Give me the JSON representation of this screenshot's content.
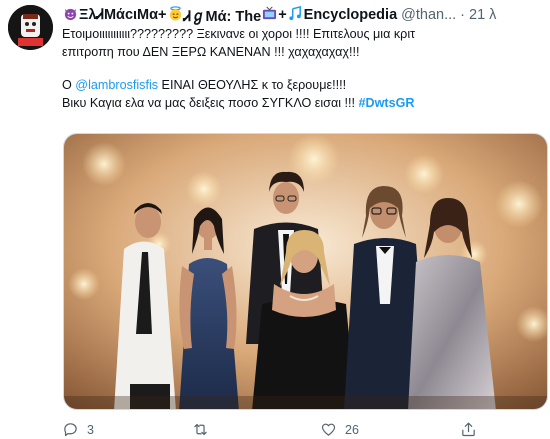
{
  "tweet": {
    "display_name_1": "ΞλᏗΜάcιΜα",
    "display_name_2": "ᏗℊΜά: The",
    "display_name_3": "Encyclopedia",
    "handle": "@than...",
    "dot": "·",
    "time": "21 λ",
    "lines": [
      "Ετοιμοιιιιιιιιιιι????????? Ξεκινανε οι χοροι !!!!  Επιτελους μια κριτ",
      "επιτροπη που ΔΕΝ ΞΕΡΩ ΚΑΝΕΝΑΝ !!! χαχαχαχαχ!!!"
    ],
    "line3_prefix": "Ο ",
    "mention": "@lambrosfisfis",
    "line3_suffix": " ΕΙΝΑΙ ΘΕΟΥΛΗΣ κ το ξερουμε!!!!",
    "line4_prefix": "Βικυ Καγια ελα να μας δειξεις ποσο ΣΥΓΚΛΟ εισαι !!! ",
    "hashtag": "#DwtsGR"
  },
  "actions": {
    "replies": "3",
    "retweets": "",
    "likes": "26"
  },
  "colors": {
    "link": "#1d9bf0",
    "secondary_text": "#536471"
  },
  "icons": [
    "avatar",
    "devil-emoji",
    "angel-emoji",
    "tv-emoji",
    "music-notes-emoji",
    "more-icon",
    "reply-icon",
    "retweet-icon",
    "like-icon",
    "share-icon"
  ]
}
